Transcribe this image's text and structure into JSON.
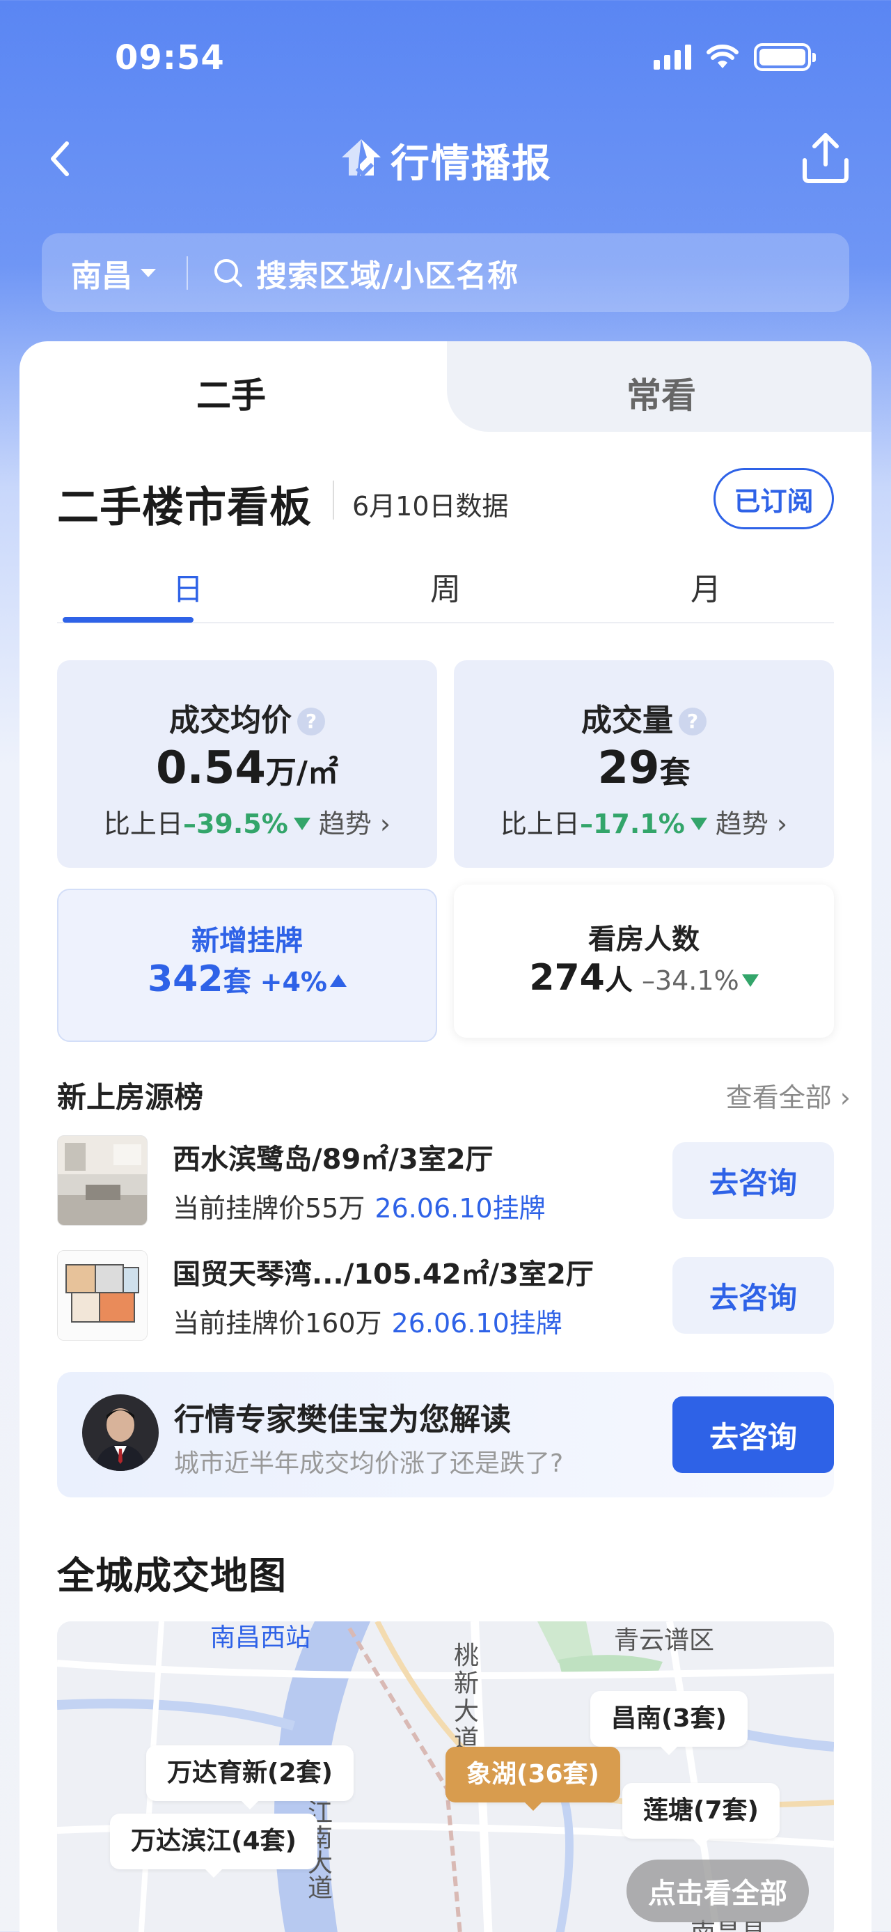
{
  "status": {
    "time": "09:54"
  },
  "nav": {
    "title": "行情播报"
  },
  "search": {
    "city": "南昌",
    "placeholder": "搜索区域/小区名称"
  },
  "tabs": [
    {
      "label": "二手",
      "active": true
    },
    {
      "label": "常看",
      "active": false
    }
  ],
  "board": {
    "title": "二手楼市看板",
    "date": "6月10日数据",
    "subscribe": "已订阅"
  },
  "periods": [
    "日",
    "周",
    "月"
  ],
  "stats": {
    "avg_price": {
      "label": "成交均价",
      "value": "0.54",
      "unit": "万/㎡",
      "compare_prefix": "比上日",
      "change": "–39.5%",
      "trend": "趋势"
    },
    "volume": {
      "label": "成交量",
      "value": "29",
      "unit": "套",
      "compare_prefix": "比上日",
      "change": "–17.1%",
      "trend": "趋势"
    },
    "new_listings": {
      "label": "新增挂牌",
      "value": "342",
      "unit": "套",
      "change": "+4%"
    },
    "viewers": {
      "label": "看房人数",
      "value": "274",
      "unit": "人",
      "change": "–34.1%"
    }
  },
  "new_listings_section": {
    "title": "新上房源榜",
    "view_all": "查看全部"
  },
  "listings": [
    {
      "name": "西水滨鹭岛/89㎡/3室2厅",
      "price": "当前挂牌价55万",
      "date": "26.06.10挂牌",
      "action": "去咨询"
    },
    {
      "name": "国贸天琴湾.../105.42㎡/3室2厅",
      "price": "当前挂牌价160万",
      "date": "26.06.10挂牌",
      "action": "去咨询"
    }
  ],
  "expert": {
    "title": "行情专家樊佳宝为您解读",
    "subtitle": "城市近半年成交均价涨了还是跌了?",
    "action": "去咨询"
  },
  "map": {
    "title": "全城成交地图",
    "labels": [
      {
        "text": "昌南(3套)",
        "hot": false
      },
      {
        "text": "万达育新(2套)",
        "hot": false
      },
      {
        "text": "象湖(36套)",
        "hot": true
      },
      {
        "text": "莲塘(7套)",
        "hot": false
      },
      {
        "text": "万达滨江(4套)",
        "hot": false
      }
    ],
    "place_names": [
      "南昌西站",
      "青云谱区",
      "桃新大道",
      "江南大道",
      "南昌县"
    ],
    "view_all": "点击看全部"
  },
  "colors": {
    "accent": "#2e62e7",
    "down": "#33a56a",
    "hot_label": "#d89c4e"
  }
}
